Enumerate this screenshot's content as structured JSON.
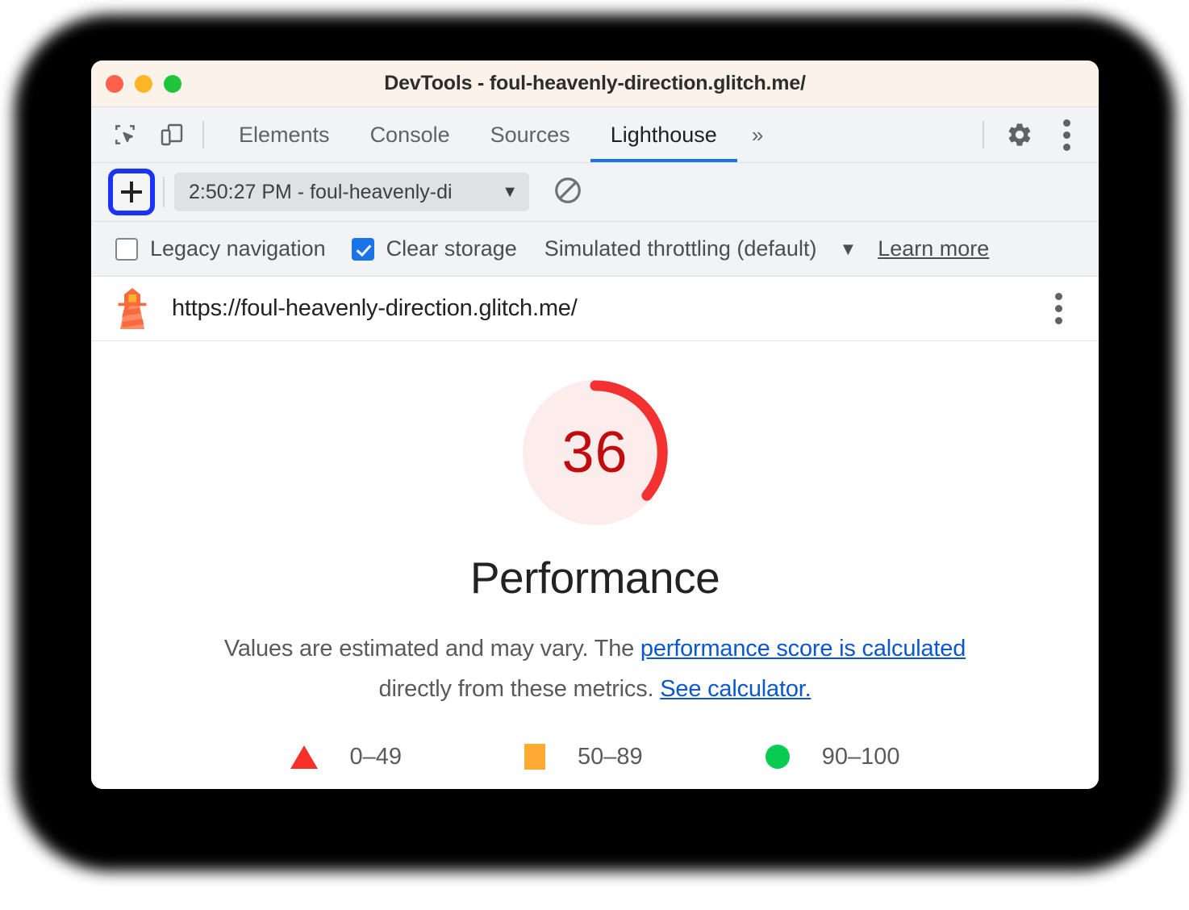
{
  "window": {
    "title": "DevTools - foul-heavenly-direction.glitch.me/",
    "traffic_lights": [
      "close",
      "minimize",
      "zoom"
    ]
  },
  "tabstrip": {
    "icons": [
      {
        "name": "inspect-element-icon"
      },
      {
        "name": "device-toolbar-icon"
      }
    ],
    "tabs": [
      {
        "label": "Elements",
        "active": false
      },
      {
        "label": "Console",
        "active": false
      },
      {
        "label": "Sources",
        "active": false
      },
      {
        "label": "Lighthouse",
        "active": true
      }
    ],
    "more_tabs": "»",
    "settings_icon": "gear-icon",
    "menu_icon": "kebab-icon"
  },
  "lighthouse_toolbar": {
    "new_report_label": "+",
    "run_selector_value": "2:50:27 PM - foul-heavenly-di",
    "run_selector_caret": "▼",
    "clear_icon": "no-entry-icon"
  },
  "options": {
    "legacy_navigation": {
      "label": "Legacy navigation",
      "checked": false
    },
    "clear_storage": {
      "label": "Clear storage",
      "checked": true
    },
    "throttling": {
      "label": "Simulated throttling (default)",
      "caret": "▼"
    },
    "learn_more": "Learn more"
  },
  "report_header": {
    "url": "https://foul-heavenly-direction.glitch.me/",
    "logo": "lighthouse-icon",
    "menu": "kebab-icon"
  },
  "report": {
    "category": "Performance",
    "disclaimer_part1": "Values are estimated and may vary. The ",
    "disclaimer_link1": "performance score is calculated",
    "disclaimer_part2": " directly from these metrics. ",
    "disclaimer_link2": "See calculator.",
    "legend": [
      {
        "shape": "triangle",
        "label": "0–49",
        "color": "#f92f2a"
      },
      {
        "shape": "square",
        "label": "50–89",
        "color": "#ffaa33"
      },
      {
        "shape": "circle",
        "label": "90–100",
        "color": "#06cc52"
      }
    ]
  },
  "chart_data": {
    "type": "gauge",
    "title": "Performance",
    "value": 36,
    "display_value": "36",
    "min": 0,
    "max": 100,
    "arc_color": "#f33131",
    "track_color": "#fdecec",
    "text_color": "#c00c0c",
    "bands": [
      {
        "name": "fail",
        "range": [
          0,
          49
        ],
        "color": "#f92f2a",
        "shape": "triangle"
      },
      {
        "name": "average",
        "range": [
          50,
          89
        ],
        "color": "#ffaa33",
        "shape": "square"
      },
      {
        "name": "pass",
        "range": [
          90,
          100
        ],
        "color": "#06cc52",
        "shape": "circle"
      }
    ]
  },
  "colors": {
    "accent_blue": "#1a73e8",
    "highlight_ring": "#1a34f5",
    "titlebar_bg": "#fbf3ea",
    "toolbar_bg": "#f1f3f4",
    "link": "#0b57d0"
  }
}
